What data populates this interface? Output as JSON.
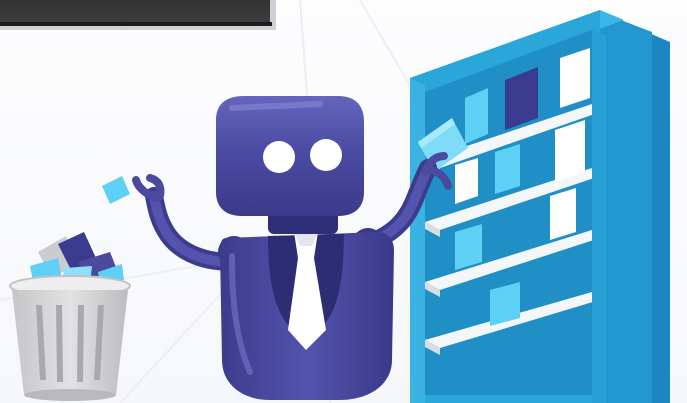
{
  "illustration": {
    "colors": {
      "robot_body": "#4b4a9e",
      "robot_dark": "#383785",
      "robot_highlight": "#6f6ec4",
      "tie": "#ffffff",
      "shelf_front": "#2ba6d8",
      "shelf_dark": "#1b86c0",
      "shelf_board": "#f7f9fb",
      "card_light": "#5fd0f5",
      "card_dark": "#3a3a8f",
      "trash_can": "#d5d5d7",
      "trash_shade": "#b9b9bc",
      "screen_frame": "#2c2c2c"
    },
    "icons": [
      "robot-icon",
      "bookshelf-icon",
      "trash-can-icon",
      "file-card-icon",
      "monitor-icon"
    ]
  }
}
